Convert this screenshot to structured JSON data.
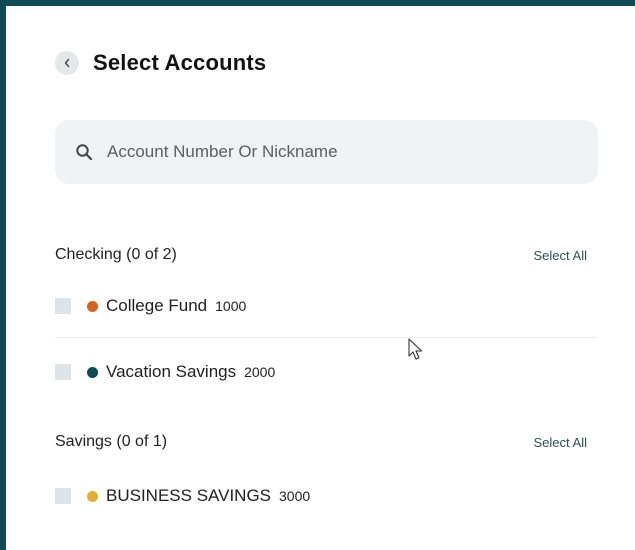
{
  "header": {
    "title": "Select Accounts"
  },
  "search": {
    "placeholder": "Account Number Or Nickname"
  },
  "sections": [
    {
      "title": "Checking (0 of 2)",
      "select_all_label": "Select All",
      "accounts": [
        {
          "name": "College Fund",
          "number": "1000",
          "dot_color": "#d4621e"
        },
        {
          "name": "Vacation Savings",
          "number": "2000",
          "dot_color": "#0f4a55"
        }
      ]
    },
    {
      "title": "Savings (0 of 1)",
      "select_all_label": "Select All",
      "accounts": [
        {
          "name": "BUSINESS SAVINGS",
          "number": "3000",
          "dot_color": "#e2ae34"
        }
      ]
    }
  ],
  "colors": {
    "frame_border": "#0f4a55",
    "checkbox": "#dce4e7",
    "search_bg": "#f0f2f3"
  },
  "icons": [
    "chevron-left-icon",
    "search-icon",
    "mouse-pointer-icon"
  ]
}
